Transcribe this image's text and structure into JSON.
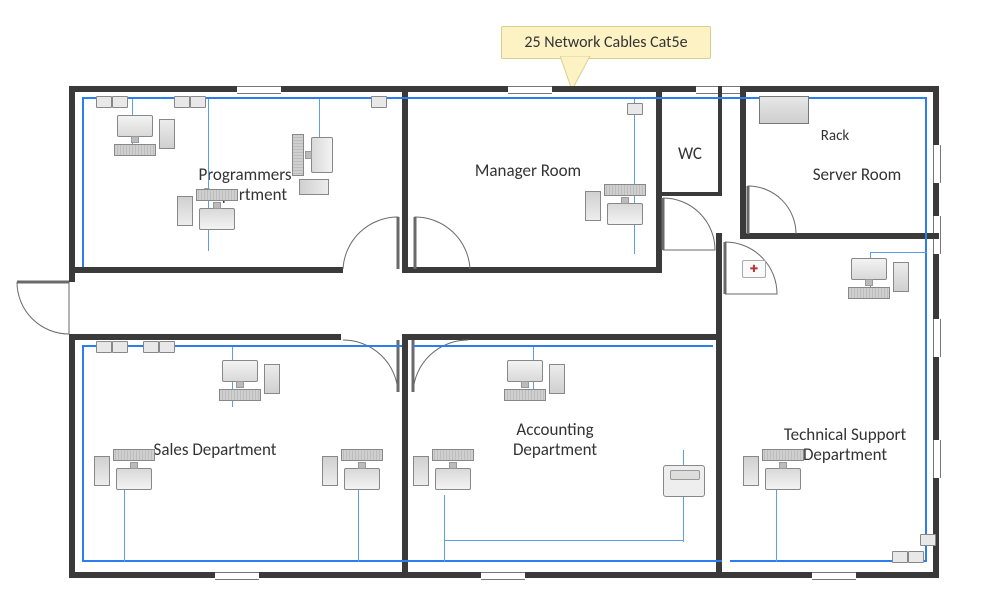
{
  "callout": {
    "text": "25 Network Cables Cat5e"
  },
  "rooms": {
    "programmers": {
      "label": "Programmers\nDepartment"
    },
    "manager": {
      "label": "Manager Room"
    },
    "wc": {
      "label": "WC"
    },
    "server": {
      "label": "Server Room"
    },
    "rack": {
      "label": "Rack"
    },
    "sales": {
      "label": "Sales Department"
    },
    "accounting": {
      "label": "Accounting\nDepartment"
    },
    "techsupport": {
      "label": "Technical Support\nDepartment"
    }
  },
  "colors": {
    "wall": "#3a3a3a",
    "cable": "#2b7df0",
    "callout_bg": "#fdf2c4"
  },
  "inventory": {
    "network_cables_cat5e": 25,
    "server_rack_count": 1,
    "rooms_total": 7
  }
}
